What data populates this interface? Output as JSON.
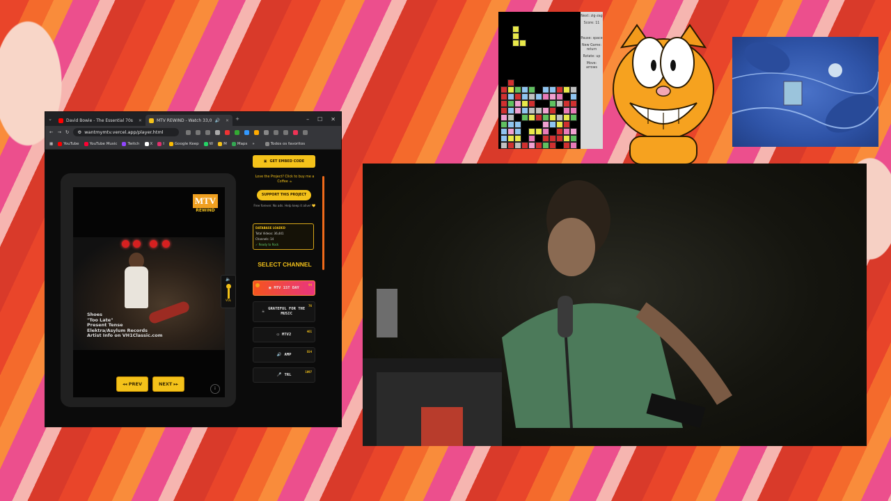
{
  "browser": {
    "tabs": [
      {
        "title": "David Bowie - The Essential 70s",
        "favicon_color": "#ff0000"
      },
      {
        "title": "MTV REWIND - Watch 33,0",
        "favicon_color": "#f4c21a"
      }
    ],
    "new_tab": "+",
    "window_controls": [
      "–",
      "☐",
      "✕"
    ],
    "url": "wantmymtv.vercel.app/player.html",
    "bookmarks": [
      {
        "label": "YouTube",
        "color": "#ff0000"
      },
      {
        "label": "YouTube Music",
        "color": "#ff0033"
      },
      {
        "label": "Twitch",
        "color": "#9146ff"
      },
      {
        "label": "X",
        "color": "#ffffff"
      },
      {
        "label": "I",
        "color": "#e1306c"
      },
      {
        "label": "Google Keep",
        "color": "#fbbc04"
      },
      {
        "label": "W",
        "color": "#25d366"
      },
      {
        "label": "M",
        "color": "#f4c21a"
      },
      {
        "label": "Maps",
        "color": "#34a853"
      },
      {
        "label": "»",
        "color": "#35363a"
      }
    ],
    "all_bookmarks": "Todos os favoritos"
  },
  "player": {
    "logo_text": "MTV",
    "logo_sub": "REWIND",
    "credits": [
      "Shoes",
      "\"Too Late\"",
      "Present Tense",
      "Elektra/Asylum Records",
      "Artist Info on VH1Classic.com"
    ],
    "prev_label": "◂◂ PREV",
    "next_label": "NEXT ▸▸",
    "info_label": "i",
    "volume_label": "VOL"
  },
  "sidebar": {
    "embed_label": "GET EMBED CODE",
    "love_text": "Love the Project? Click to buy me a Coffee ☕",
    "support_label": "SUPPORT THIS PROJECT",
    "small_text": "Free forever. No ads. Help keep it alive! 💛",
    "status": {
      "title": "DATABASE LOADED",
      "videos": "Total Videos: 36,441",
      "channels": "Channels: 14",
      "ready": "✓ Ready to Rock"
    },
    "select_channel": "SELECT CHANNEL",
    "channels": [
      {
        "label": "MTV 1ST DAY",
        "num": "94",
        "active": true
      },
      {
        "label": "GRATEFUL FOR THE MUSIC",
        "num": "76",
        "active": false
      },
      {
        "label": "MTV2",
        "num": "461",
        "active": false
      },
      {
        "label": "AMP",
        "num": "554",
        "active": false
      },
      {
        "label": "TRL",
        "num": "1097",
        "active": false
      }
    ]
  },
  "tetris": {
    "next": "Next: zig-zag",
    "score": "Score: 11",
    "pause": "Pause: space",
    "new_game": "New Game: return",
    "rotate": "Rotate: up",
    "move": "Move: arrows"
  },
  "colors": {
    "accent": "#f4c21a",
    "channel_active_start": "#f5541d",
    "channel_active_end": "#e9357f"
  }
}
